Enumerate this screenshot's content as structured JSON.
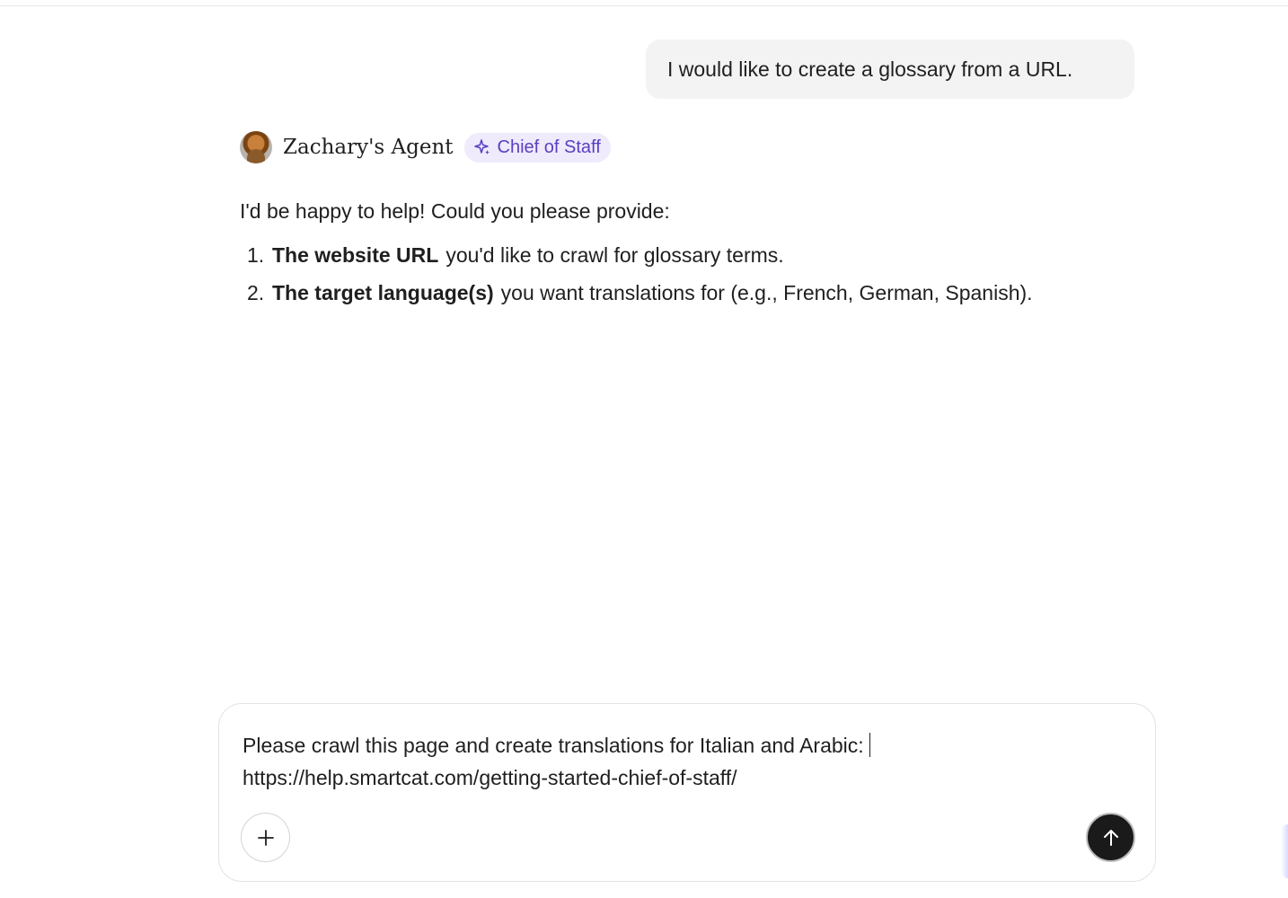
{
  "conversation": {
    "user_message": "I would like to create a glossary from a URL.",
    "agent": {
      "name": "Zachary's Agent",
      "role_badge": "Chief of Staff",
      "reply_intro": "I'd be happy to help! Could you please provide:",
      "items": [
        {
          "number": "1.",
          "bold": "The website URL",
          "rest": "you'd like to crawl for glossary terms."
        },
        {
          "number": "2.",
          "bold": "The target language(s)",
          "rest": "you want translations for (e.g., French, German, Spanish)."
        }
      ]
    }
  },
  "composer": {
    "line1": "Please crawl this page and create translations for Italian and Arabic:",
    "line2": "https://help.smartcat.com/getting-started-chief-of-staff/",
    "attach_icon": "plus-icon",
    "send_icon": "arrow-up-icon"
  },
  "colors": {
    "badge_bg": "#efeafc",
    "badge_text": "#5a3fc0",
    "send_bg": "#1a1a1a",
    "bubble_bg": "#f3f3f3"
  }
}
